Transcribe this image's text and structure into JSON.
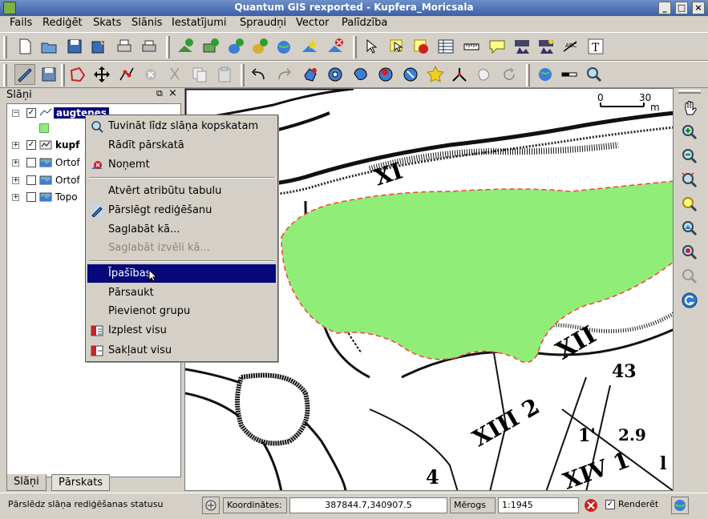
{
  "window": {
    "title": "Quantum GIS rexported - Kupfera_Moricsala"
  },
  "menubar": {
    "items": [
      "Fails",
      "Rediģēt",
      "Skats",
      "Slānis",
      "Iestatījumi",
      "Spraudņi",
      "Vector",
      "Palīdzība"
    ]
  },
  "toolbar1": {
    "icons": [
      "new-project-icon",
      "open-project-icon",
      "save-project-icon",
      "save-as-icon",
      "print-composer-icon",
      "print-icon",
      "add-vector-layer-icon",
      "add-raster-layer-icon",
      "add-postgis-layer-icon",
      "add-spatialite-layer-icon",
      "add-wms-layer-icon",
      "new-vector-layer-icon",
      "remove-layer-icon",
      "identify-icon",
      "select-icon",
      "deselect-icon",
      "open-table-icon",
      "measure-icon",
      "map-tips-icon",
      "home-bookmark-icon",
      "new-bookmark-icon",
      "label-icon",
      "text-annotation-icon"
    ]
  },
  "toolbar2": {
    "icons": [
      "toggle-editing-icon",
      "save-edits-icon",
      "capture-polygon-icon",
      "move-feature-icon",
      "node-tool-icon",
      "delete-selected-icon",
      "cut-features-icon",
      "copy-features-icon",
      "paste-features-icon",
      "undo-icon",
      "redo-icon",
      "simplify-feature-icon",
      "add-ring-icon",
      "add-island-icon",
      "delete-ring-icon",
      "delete-part-icon",
      "reshape-icon",
      "split-features-icon",
      "merge-icon",
      "rotate-icon",
      "map-navigation-icon",
      "scale-bar-icon",
      "zoom-tool-icon"
    ]
  },
  "layers_panel": {
    "title": "Slāņi",
    "layers": [
      {
        "name": "augtenes",
        "checked": true,
        "selected": true
      },
      {
        "name": "kupf",
        "checked": true,
        "selected": false
      },
      {
        "name": "Ortof",
        "checked": false,
        "selected": false
      },
      {
        "name": "Ortof",
        "checked": false,
        "selected": false
      },
      {
        "name": "Topo",
        "checked": false,
        "selected": false
      }
    ],
    "tabs": [
      "Slāņi",
      "Pārskats"
    ]
  },
  "context_menu": {
    "items": [
      {
        "label": "Tuvināt līdz slāņa kopskatam",
        "icon": "zoom-to-layer-icon",
        "state": "normal"
      },
      {
        "label": "Rādīt pārskatā",
        "icon": "",
        "state": "normal"
      },
      {
        "label": "Noņemt",
        "icon": "remove-icon",
        "state": "normal"
      },
      {
        "label": "Atvērt atribūtu tabulu",
        "icon": "",
        "state": "normal"
      },
      {
        "label": "Pārslēgt rediģēšanu",
        "icon": "toggle-editing-icon",
        "state": "normal"
      },
      {
        "label": "Saglabāt kā...",
        "icon": "",
        "state": "normal"
      },
      {
        "label": "Saglabāt izvēli kā...",
        "icon": "",
        "state": "disabled"
      },
      {
        "label": "Īpašības",
        "icon": "",
        "state": "selected"
      },
      {
        "label": "Pārsaukt",
        "icon": "",
        "state": "normal"
      },
      {
        "label": "Pievienot grupu",
        "icon": "",
        "state": "normal"
      },
      {
        "label": "Izplest visu",
        "icon": "expand-all-icon",
        "state": "normal"
      },
      {
        "label": "Sakļaut visu",
        "icon": "collapse-all-icon",
        "state": "normal"
      }
    ]
  },
  "map": {
    "scalebar_labels": [
      "0",
      "30",
      "m"
    ],
    "annotations": [
      "XI",
      "XII",
      "XIII 2",
      "XIV 1",
      "43",
      "1'",
      "2.9",
      "4",
      "l"
    ]
  },
  "right_toolbar": {
    "icons": [
      "pan-icon",
      "zoom-in-icon",
      "zoom-out-icon",
      "zoom-full-icon",
      "zoom-selection-icon",
      "zoom-layer-icon",
      "zoom-last-icon",
      "zoom-actual-icon",
      "refresh-icon"
    ]
  },
  "statusbar": {
    "message": "Pārslēdz slāņa rediģēšanas statusu",
    "coord_label": "Koordinātes:",
    "coord_value": "387844.7,340907.5",
    "scale_label": "Mērogs",
    "scale_value": "1:1945",
    "render_label": "Renderēt",
    "render_checked": true
  },
  "colors": {
    "selection": "#06087a",
    "polygon_fill": "#90ee78",
    "vertex_marker": "#ff0000",
    "titlebar": "#3b5fa8"
  }
}
